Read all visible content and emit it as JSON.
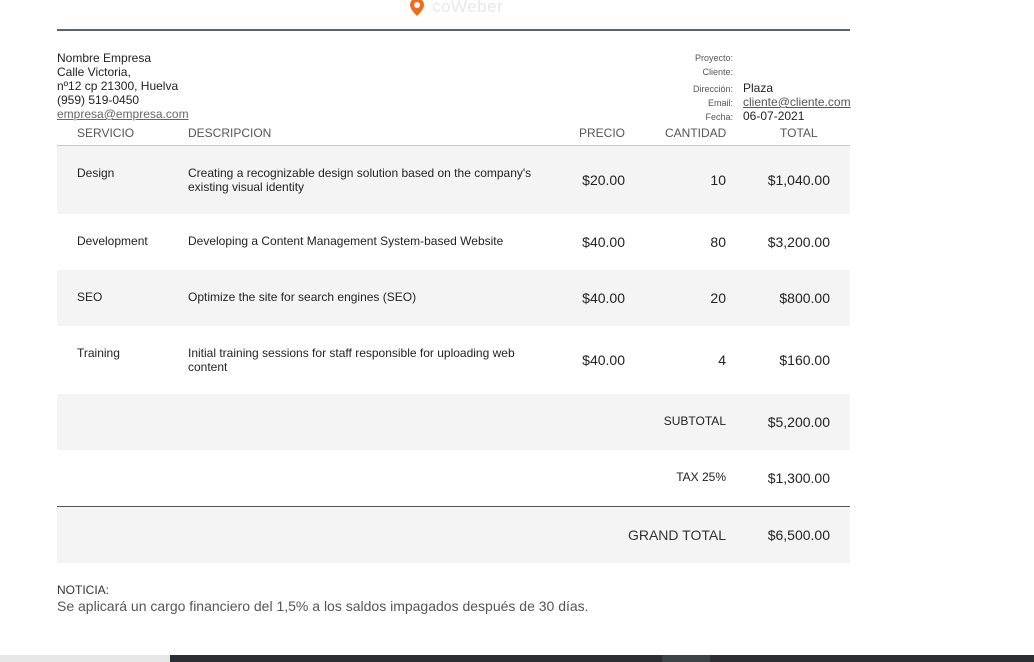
{
  "logo": {
    "text": "coWeber",
    "icon": "location-pin-icon",
    "accent": "#f26b1d"
  },
  "company": {
    "name": "Nombre Empresa",
    "street": "Calle Victoria,",
    "city": "nº12 cp 21300, Huelva",
    "phone": "(959) 519-0450",
    "email": "empresa@empresa.com"
  },
  "project": {
    "rows": [
      {
        "label": "Proyecto:",
        "value": ""
      },
      {
        "label": "Cliente:",
        "value": ""
      },
      {
        "label": "Dirección:",
        "value": "Plaza"
      },
      {
        "label": "Email:",
        "value": "cliente@cliente.com"
      },
      {
        "label": "Fecha:",
        "value": "06-07-2021"
      }
    ]
  },
  "table": {
    "headers": {
      "service": "SERVICIO",
      "description": "DESCRIPCION",
      "price": "PRECIO",
      "quantity": "CANTIDAD",
      "total": "TOTAL"
    },
    "rows": [
      {
        "service": "Design",
        "description": "Creating a recognizable design solution based on the company's existing visual identity",
        "price": "$20.00",
        "quantity": "10",
        "total": "$1,040.00"
      },
      {
        "service": "Development",
        "description": "Developing a Content Management System-based Website",
        "price": "$40.00",
        "quantity": "80",
        "total": "$3,200.00"
      },
      {
        "service": "SEO",
        "description": "Optimize the site for search engines (SEO)",
        "price": "$40.00",
        "quantity": "20",
        "total": "$800.00"
      },
      {
        "service": "Training",
        "description": "Initial training sessions for staff responsible for uploading web content",
        "price": "$40.00",
        "quantity": "4",
        "total": "$160.00"
      }
    ],
    "subtotal": {
      "label": "SUBTOTAL",
      "value": "$5,200.00"
    },
    "tax": {
      "label": "TAX 25%",
      "value": "$1,300.00"
    },
    "grand_total": {
      "label": "GRAND TOTAL",
      "value": "$6,500.00"
    }
  },
  "notice": {
    "title": "NOTICIA:",
    "text": "Se aplicará un cargo financiero del 1,5% a los saldos impagados después de 30 días."
  },
  "colors": {
    "rule": "#5b6270",
    "row_shade": "#f4f4f4",
    "text": "#222222"
  }
}
